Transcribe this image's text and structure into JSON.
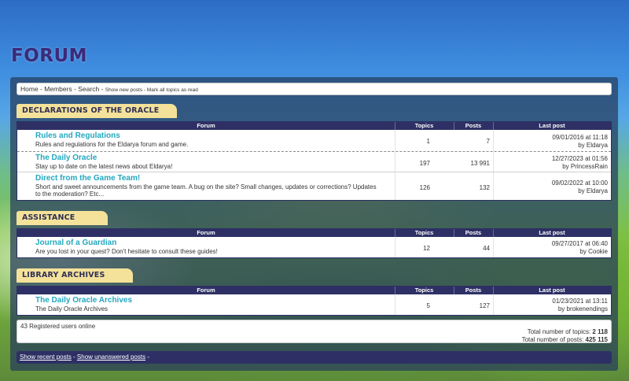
{
  "page": {
    "title": "FORUM"
  },
  "nav": {
    "home": "Home",
    "members": "Members",
    "search": "Search",
    "show_new_posts": "Show new posts",
    "mark_all_read": "Mark all topics as read",
    "sep": " - "
  },
  "columns": {
    "forum": "Forum",
    "topics": "Topics",
    "posts": "Posts",
    "last_post": "Last post"
  },
  "categories": [
    {
      "name": "DECLARATIONS OF THE ORACLE",
      "forums": [
        {
          "name": "Rules and Regulations",
          "desc": "Rules and regulations for the Eldarya forum and game.",
          "topics": "1",
          "posts": "7",
          "last_date": "09/01/2016 at 11:18",
          "last_by": "by Eldarya"
        },
        {
          "name": "The Daily Oracle",
          "desc": "Stay up to date on the latest news about Eldarya!",
          "topics": "197",
          "posts": "13 991",
          "last_date": "12/27/2023 at 01:56",
          "last_by": "by PrincessRain"
        },
        {
          "name": "Direct from the Game Team!",
          "desc": "Short and sweet announcements from the game team. A bug on the site? Small changes, updates or corrections? Updates to the moderation? Etc...",
          "topics": "126",
          "posts": "132",
          "last_date": "09/02/2022 at 10:00",
          "last_by": "by Eldarya"
        }
      ]
    },
    {
      "name": "ASSISTANCE",
      "forums": [
        {
          "name": "Journal of a Guardian",
          "desc": "Are you lost in your quest? Don't hesitate to consult these guides!",
          "topics": "12",
          "posts": "44",
          "last_date": "09/27/2017 at 06:40",
          "last_by": "by Cookie"
        }
      ]
    },
    {
      "name": "LIBRARY ARCHIVES",
      "forums": [
        {
          "name": "The Daily Oracle Archives",
          "desc": "The Daily Oracle Archives",
          "topics": "5",
          "posts": "127",
          "last_date": "01/23/2021 at 13:11",
          "last_by": "by brokenendings"
        }
      ]
    }
  ],
  "stats": {
    "online": "43 Registered users online",
    "total_topics_label": "Total number of topics: ",
    "total_topics": "2 118",
    "total_posts_label": "Total number of posts: ",
    "total_posts": "425 115"
  },
  "footer": {
    "recent": "Show recent posts",
    "unanswered": "Show unanswered posts",
    "sep": " - ",
    "trail": " -"
  }
}
